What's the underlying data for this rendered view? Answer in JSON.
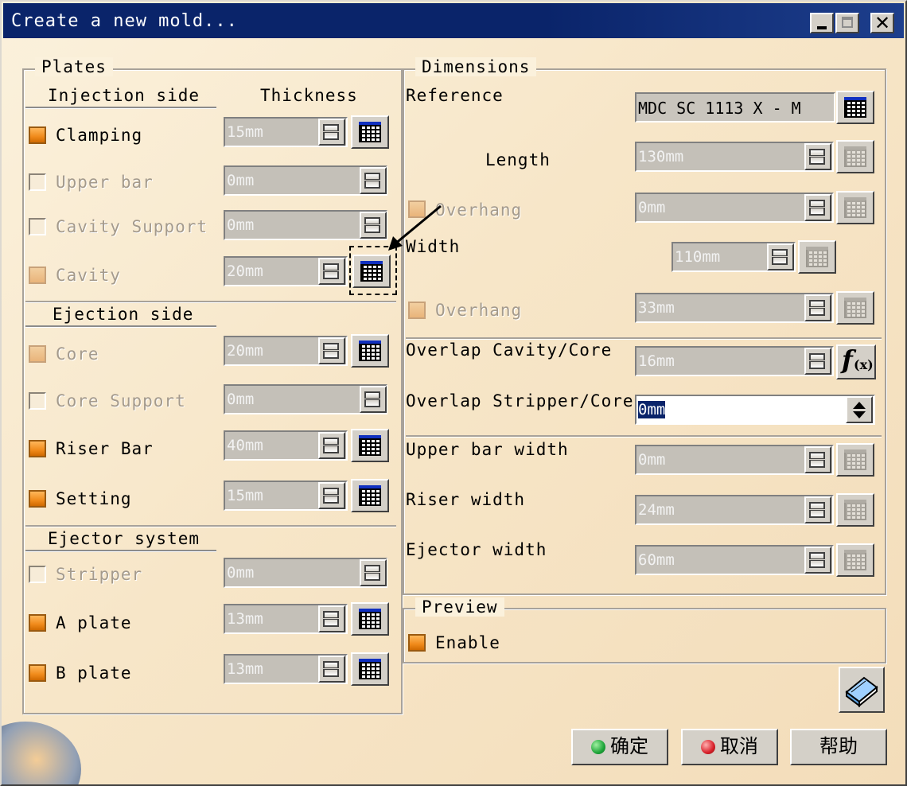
{
  "window": {
    "title": "Create a new mold..."
  },
  "plates": {
    "title": "Plates",
    "thickness_header": "Thickness",
    "injection_title": "Injection side",
    "ejection_title": "Ejection side",
    "ejector_title": "Ejector system",
    "rows": [
      {
        "label": "Clamping",
        "value": "15mm"
      },
      {
        "label": "Upper bar",
        "value": "0mm"
      },
      {
        "label": "Cavity Support",
        "value": "0mm"
      },
      {
        "label": "Cavity",
        "value": "20mm"
      },
      {
        "label": "Core",
        "value": "20mm"
      },
      {
        "label": "Core Support",
        "value": "0mm"
      },
      {
        "label": "Riser Bar",
        "value": "40mm"
      },
      {
        "label": "Setting",
        "value": "15mm"
      },
      {
        "label": "Stripper",
        "value": "0mm"
      },
      {
        "label": "A plate",
        "value": "13mm"
      },
      {
        "label": "B plate",
        "value": "13mm"
      }
    ]
  },
  "dimensions": {
    "title": "Dimensions",
    "reference_label": "Reference",
    "reference_value": "MDC SC 1113 X - M",
    "length_label": "Length",
    "length_value": "130mm",
    "overhang1_label": "Overhang",
    "overhang1_value": "0mm",
    "width_label": "Width",
    "width_value": "110mm",
    "overhang2_label": "Overhang",
    "overhang2_value": "33mm",
    "overlap_cavity_label": "Overlap Cavity/Core",
    "overlap_cavity_value": "16mm",
    "overlap_stripper_label": "Overlap Stripper/Core",
    "overlap_stripper_value": "0mm",
    "upper_bar_width_label": "Upper bar width",
    "upper_bar_width_value": "0mm",
    "riser_width_label": "Riser width",
    "riser_width_value": "24mm",
    "ejector_width_label": "Ejector width",
    "ejector_width_value": "60mm"
  },
  "preview": {
    "title": "Preview",
    "enable_label": "Enable"
  },
  "buttons": {
    "ok": "确定",
    "cancel": "取消",
    "help": "帮助"
  },
  "colors": {
    "title_bar": "#0a246a",
    "checkbox_on": "#f08a1a",
    "ok_dot": "#1fa53a",
    "cancel_dot": "#d8202a"
  },
  "icons": [
    "minimize-icon",
    "maximize-icon",
    "close-icon",
    "formula-icon",
    "calendar-grid-icon",
    "book-icon",
    "arrow-pointer-icon"
  ]
}
